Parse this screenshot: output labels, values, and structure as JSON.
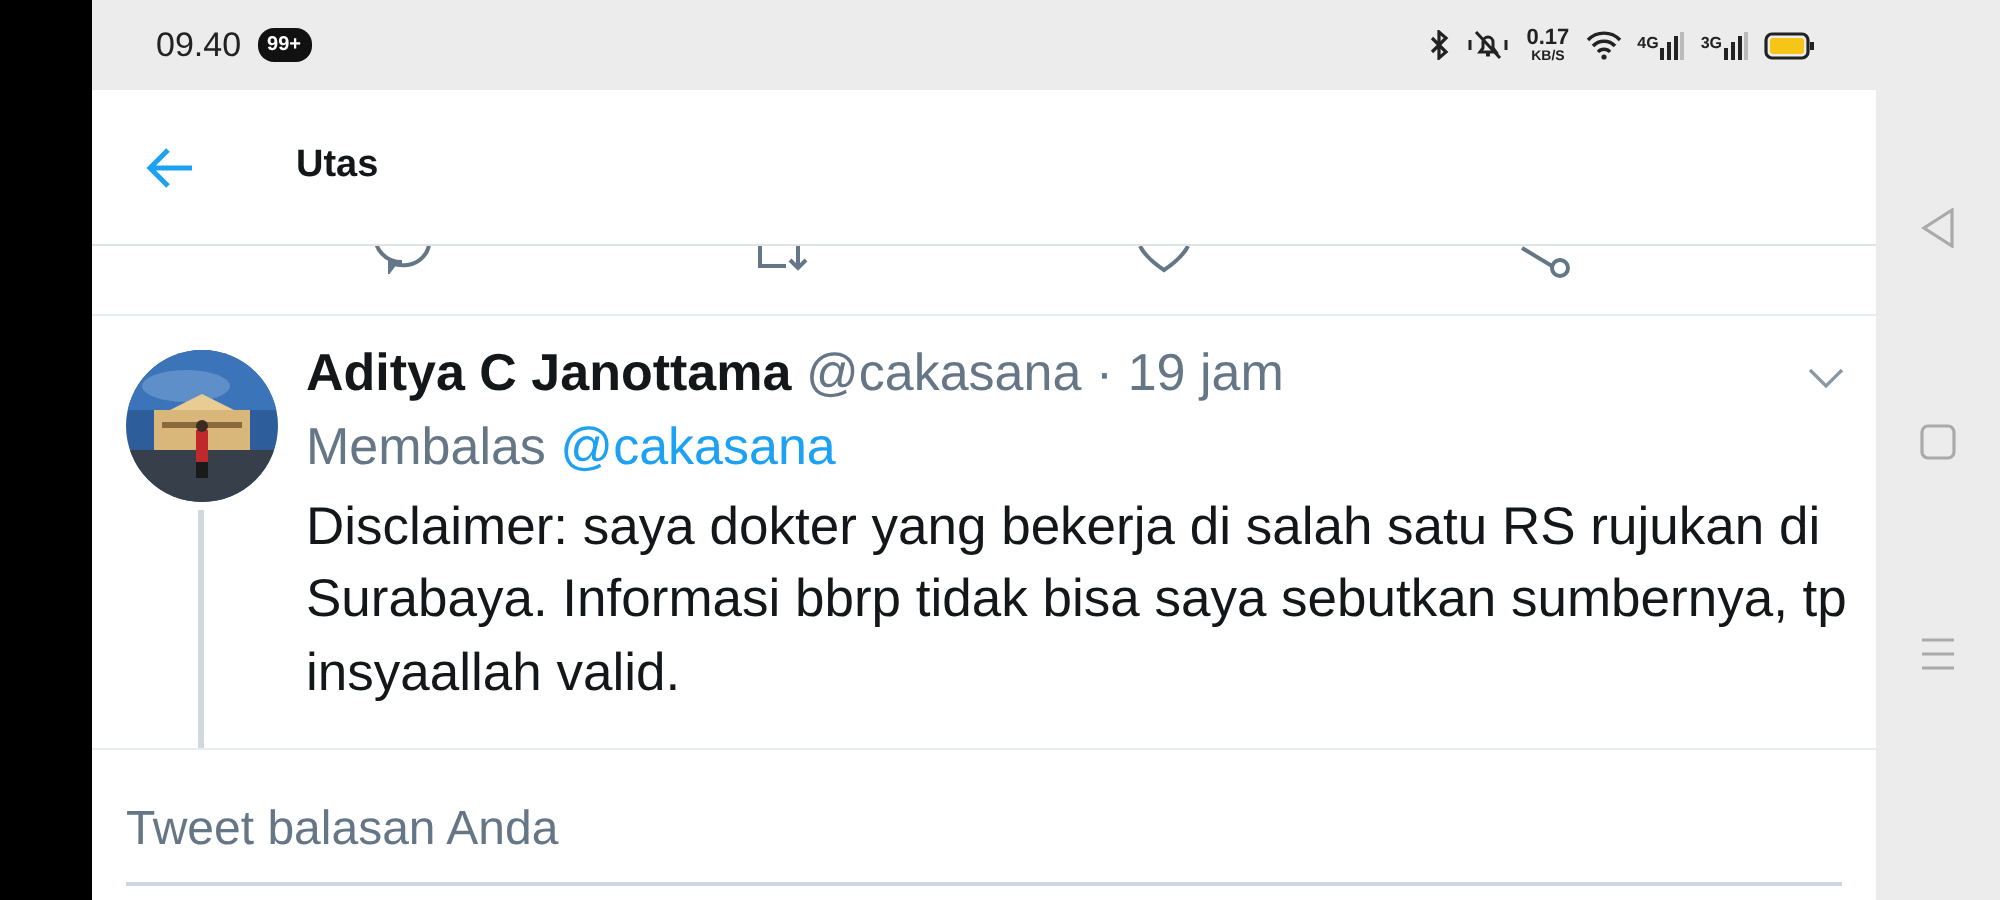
{
  "status_bar": {
    "time": "09.40",
    "notification_badge": "99+",
    "network_speed": "0.17",
    "network_speed_unit": "KB/S",
    "signal_labels": [
      "4G",
      "3G"
    ]
  },
  "header": {
    "title": "Utas"
  },
  "tweet": {
    "author_name": "Aditya C Janottama",
    "handle": "@cakasana",
    "separator": "·",
    "time": "19 jam",
    "replying_label": "Membalas",
    "reply_to": "@cakasana",
    "body": "Disclaimer: saya dokter yang bekerja di salah satu RS rujukan di Surabaya. Informasi bbrp tidak bisa saya sebutkan sumbernya, tp insyaallah valid."
  },
  "reply_field": {
    "placeholder": "Tweet balasan Anda"
  }
}
